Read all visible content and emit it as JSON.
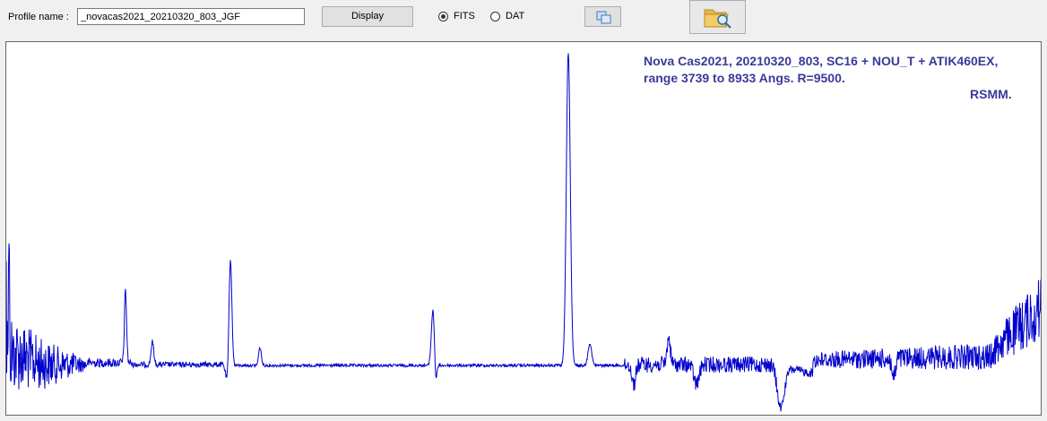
{
  "toolbar": {
    "profile_label": "Profile name :",
    "profile_value": "_novacas2021_20210320_803_JGF",
    "display_label": "Display",
    "format_options": [
      {
        "label": "FITS",
        "selected": true
      },
      {
        "label": "DAT",
        "selected": false
      }
    ],
    "copy_icon": "copy-icon",
    "folder_icon": "folder-search-icon"
  },
  "plot": {
    "annotation_line1": "Nova Cas2021, 20210320_803,  SC16 + NOU_T + ATIK460EX,",
    "annotation_line2": "range 3739 to 8933 Angs. R=9500.",
    "annotation_line3": "RSMM.",
    "trace_color": "#0000cc",
    "text_color": "#3a3a9a"
  }
}
